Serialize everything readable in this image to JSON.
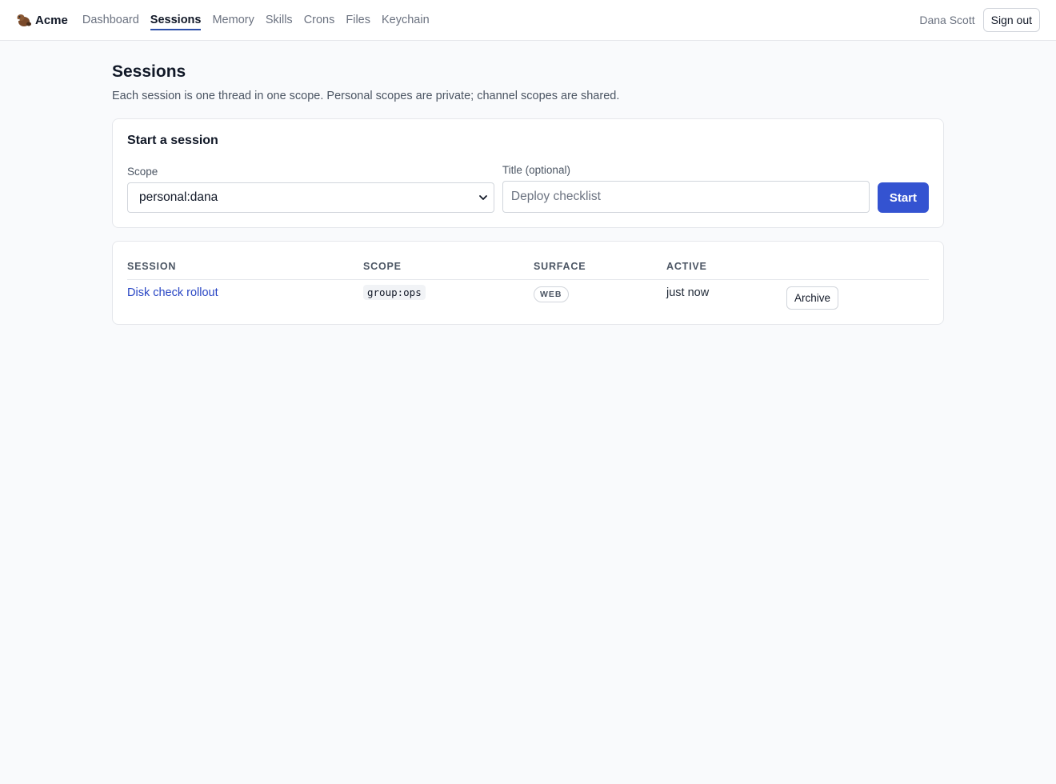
{
  "app": {
    "brand": "Acme",
    "logo_icon": "beaver-logo-icon"
  },
  "nav": {
    "items": [
      {
        "label": "Dashboard",
        "active": false
      },
      {
        "label": "Sessions",
        "active": true
      },
      {
        "label": "Memory",
        "active": false
      },
      {
        "label": "Skills",
        "active": false
      },
      {
        "label": "Crons",
        "active": false
      },
      {
        "label": "Files",
        "active": false
      },
      {
        "label": "Keychain",
        "active": false
      }
    ],
    "user_name": "Dana Scott",
    "sign_out_label": "Sign out"
  },
  "page": {
    "title": "Sessions",
    "description": "Each session is one thread in one scope. Personal scopes are private; channel scopes are shared."
  },
  "start_form": {
    "title": "Start a session",
    "scope_label": "Scope",
    "scope_value": "personal:dana",
    "title_label": "Title (optional)",
    "title_placeholder": "Deploy checklist",
    "title_value": "",
    "start_label": "Start"
  },
  "sessions_table": {
    "columns": [
      "Session",
      "Scope",
      "Surface",
      "Active"
    ],
    "rows": [
      {
        "session": "Disk check rollout",
        "scope": "group:ops",
        "surface": "WEB",
        "active": "just now",
        "action_label": "Archive"
      }
    ]
  },
  "colors": {
    "accent": "#3453d1",
    "link": "#2946c4",
    "active_underline": "#2d4fa8",
    "background": "#f9fafc"
  }
}
